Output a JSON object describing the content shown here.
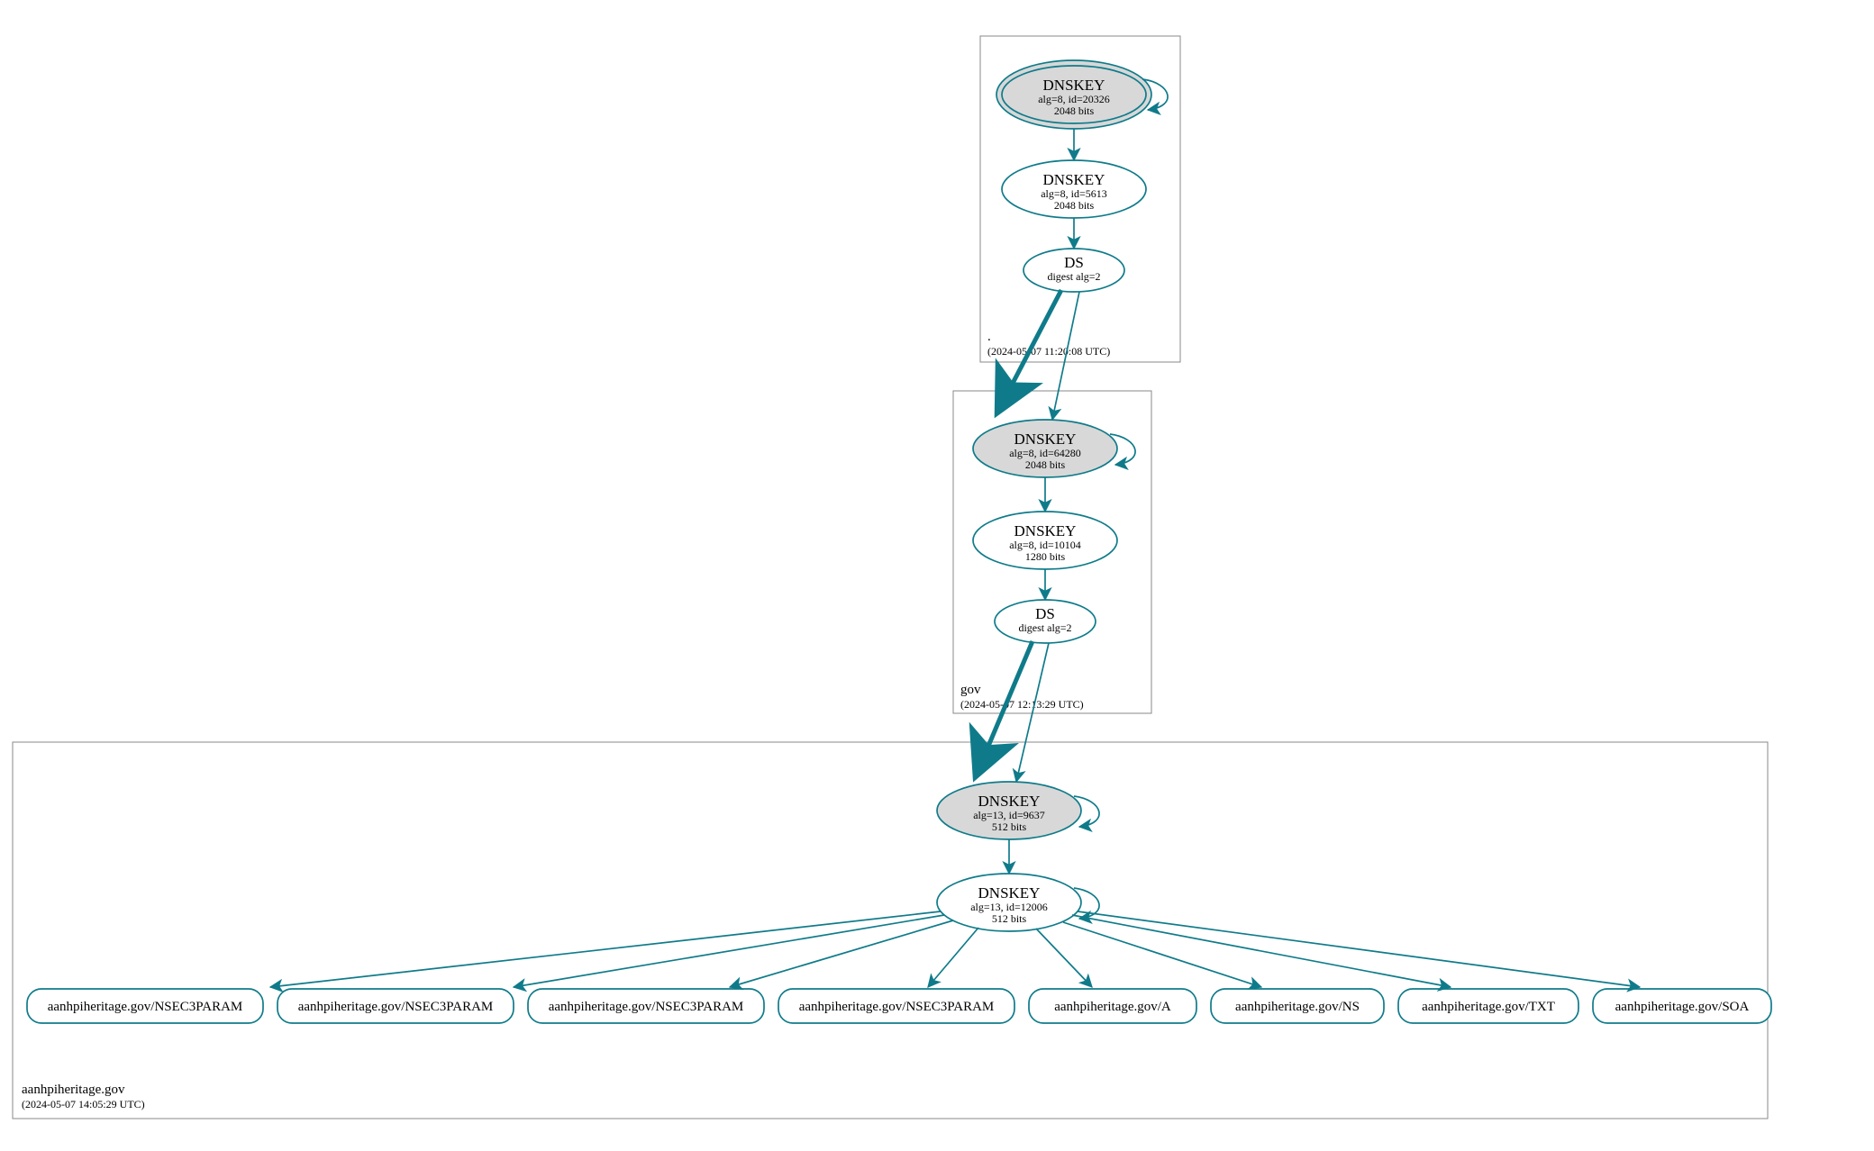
{
  "zones": {
    "root": {
      "name": ".",
      "timestamp": "(2024-05-07 11:20:08 UTC)"
    },
    "gov": {
      "name": "gov",
      "timestamp": "(2024-05-07 12:13:29 UTC)"
    },
    "domain": {
      "name": "aanhpiheritage.gov",
      "timestamp": "(2024-05-07 14:05:29 UTC)"
    }
  },
  "nodes": {
    "root_ksk": {
      "title": "DNSKEY",
      "sub1": "alg=8, id=20326",
      "sub2": "2048 bits"
    },
    "root_zsk": {
      "title": "DNSKEY",
      "sub1": "alg=8, id=5613",
      "sub2": "2048 bits"
    },
    "root_ds": {
      "title": "DS",
      "sub1": "digest alg=2"
    },
    "gov_ksk": {
      "title": "DNSKEY",
      "sub1": "alg=8, id=64280",
      "sub2": "2048 bits"
    },
    "gov_zsk": {
      "title": "DNSKEY",
      "sub1": "alg=8, id=10104",
      "sub2": "1280 bits"
    },
    "gov_ds": {
      "title": "DS",
      "sub1": "digest alg=2"
    },
    "dom_ksk": {
      "title": "DNSKEY",
      "sub1": "alg=13, id=9637",
      "sub2": "512 bits"
    },
    "dom_zsk": {
      "title": "DNSKEY",
      "sub1": "alg=13, id=12006",
      "sub2": "512 bits"
    }
  },
  "records": {
    "r1": "aanhpiheritage.gov/NSEC3PARAM",
    "r2": "aanhpiheritage.gov/NSEC3PARAM",
    "r3": "aanhpiheritage.gov/NSEC3PARAM",
    "r4": "aanhpiheritage.gov/NSEC3PARAM",
    "r5": "aanhpiheritage.gov/A",
    "r6": "aanhpiheritage.gov/NS",
    "r7": "aanhpiheritage.gov/TXT",
    "r8": "aanhpiheritage.gov/SOA"
  }
}
